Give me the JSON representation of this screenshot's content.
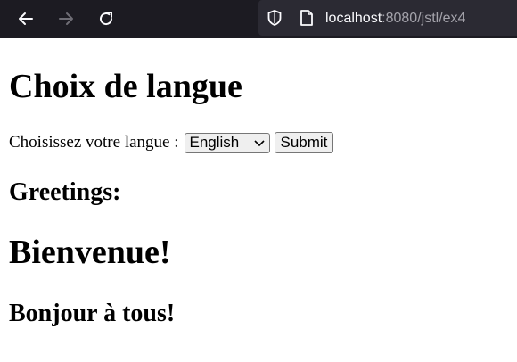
{
  "browser": {
    "url_host": "localhost",
    "url_rest": ":8080/jstl/ex4",
    "icons": [
      "back-icon",
      "forward-icon",
      "reload-icon",
      "shield-icon",
      "page-icon"
    ]
  },
  "page": {
    "title": "Choix de langue",
    "form": {
      "label": "Choisissez votre langue :",
      "selected_language": "English",
      "submit_label": "Submit"
    },
    "greetings_heading": "Greetings:",
    "welcome": "Bienvenue!",
    "hello_all": "Bonjour à tous!"
  }
}
